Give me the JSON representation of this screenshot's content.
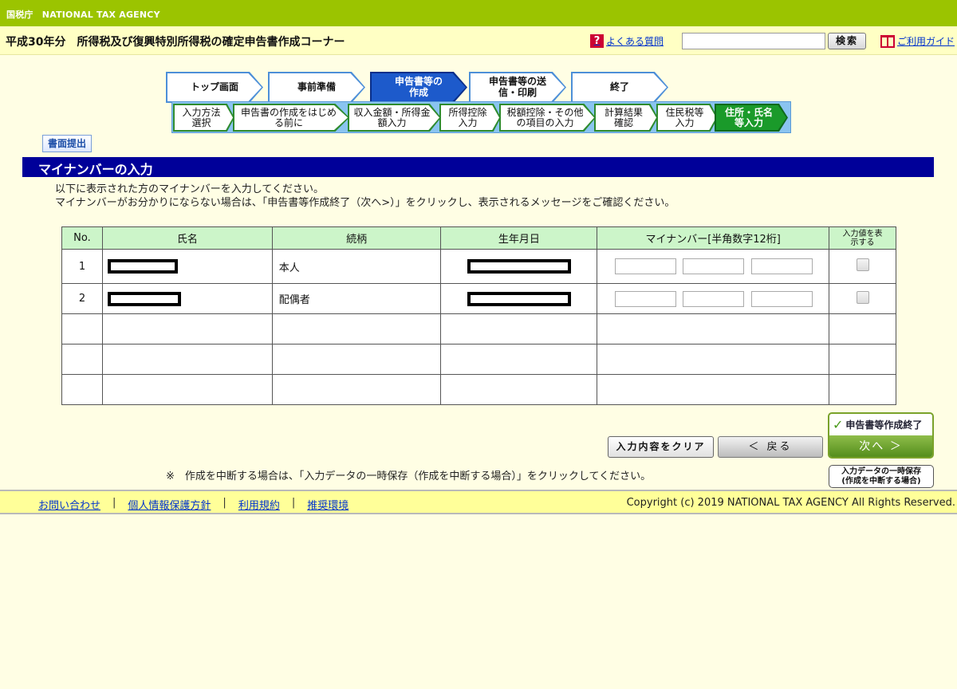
{
  "header": {
    "agency": "国税庁　NATIONAL TAX AGENCY",
    "page_title": "平成30年分　所得税及び復興特別所得税の確定申告書作成コーナー",
    "faq_label": "よくある質問",
    "search_placeholder": "",
    "search_button": "検索",
    "guide_label": "ご利用ガイド"
  },
  "steps": {
    "main": [
      "トップ画面",
      "事前準備",
      "申告書等の作成",
      "申告書等の送信・印刷",
      "終了"
    ],
    "active_main": "申告書等の作成",
    "sub": [
      "入力方法選択",
      "申告書の作成をはじめる前に",
      "収入金額・所得金額入力",
      "所得控除入力",
      "税額控除・その他の項目の入力",
      "計算結果確認",
      "住民税等入力",
      "住所・氏名等入力"
    ],
    "active_sub": "住所・氏名等入力"
  },
  "paper_submit": "書面提出",
  "section_title": "マイナンバーの入力",
  "instructions": [
    "以下に表示された方のマイナンバーを入力してください。",
    "マイナンバーがお分かりにならない場合は、「申告書等作成終了（次へ>）」をクリックし、表示されるメッセージをご確認ください。"
  ],
  "table": {
    "headers": [
      "No.",
      "氏名",
      "続柄",
      "生年月日",
      "マイナンバー[半角数字12桁]",
      "入力値を表示する"
    ],
    "rows": [
      {
        "no": "1",
        "relation": "本人"
      },
      {
        "no": "2",
        "relation": "配偶者"
      }
    ]
  },
  "buttons": {
    "clear": "入力内容をクリア",
    "back": "＜ 戻る",
    "finish_label": "申告書等作成終了",
    "next": "次へ ＞",
    "save_line1": "入力データの一時保存",
    "save_line2": "(作成を中断する場合)"
  },
  "note": "※　作成を中断する場合は、「入力データの一時保存（作成を中断する場合）」をクリックしてください。",
  "footer": {
    "links": [
      "お問い合わせ",
      "個人情報保護方針",
      "利用規約",
      "推奨環境"
    ],
    "copyright": "Copyright (c) 2019 NATIONAL TAX AGENCY All Rights Reserved."
  },
  "colors": {
    "topbar": "#9bc400",
    "section_header": "#000099",
    "active_main_step": "#1d5acb",
    "active_sub_step": "#1a9a2a"
  }
}
